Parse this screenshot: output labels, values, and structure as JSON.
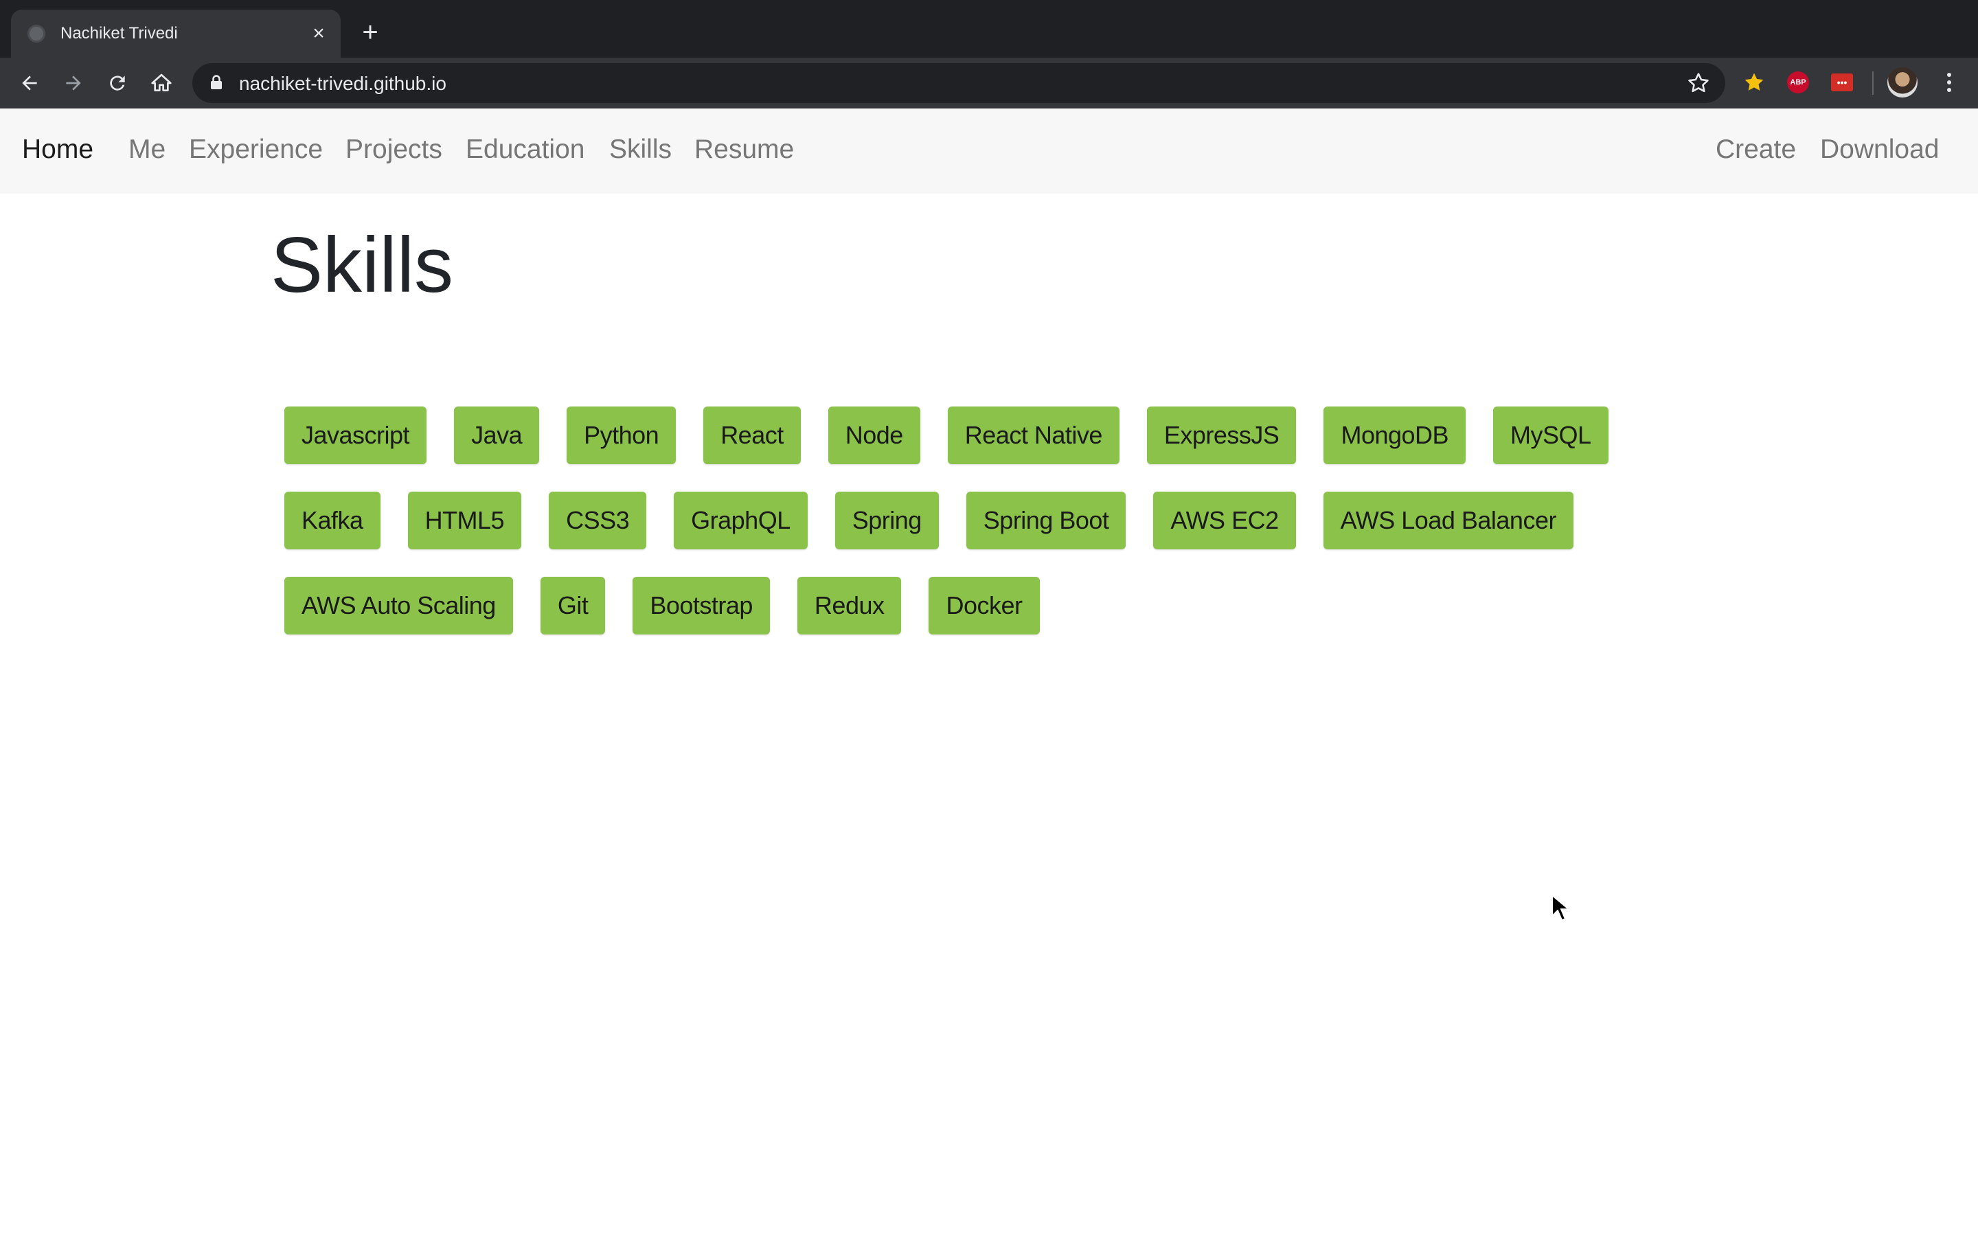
{
  "browser": {
    "tab_title": "Nachiket Trivedi",
    "url": "nachiket-trivedi.github.io",
    "extensions": {
      "abp_label": "ABP",
      "lastpass_label": "•••"
    }
  },
  "navbar": {
    "brand": "Home",
    "links": [
      "Me",
      "Experience",
      "Projects",
      "Education",
      "Skills",
      "Resume"
    ],
    "right_links": [
      "Create",
      "Download"
    ]
  },
  "page": {
    "title": "Skills",
    "skills": [
      "Javascript",
      "Java",
      "Python",
      "React",
      "Node",
      "React Native",
      "ExpressJS",
      "MongoDB",
      "MySQL",
      "Kafka",
      "HTML5",
      "CSS3",
      "GraphQL",
      "Spring",
      "Spring Boot",
      "AWS EC2",
      "AWS Load Balancer",
      "AWS Auto Scaling",
      "Git",
      "Bootstrap",
      "Redux",
      "Docker"
    ]
  },
  "colors": {
    "skill_badge": "#8bc34a",
    "navbar_bg": "#f7f7f7",
    "chrome_dark": "#35363a"
  }
}
